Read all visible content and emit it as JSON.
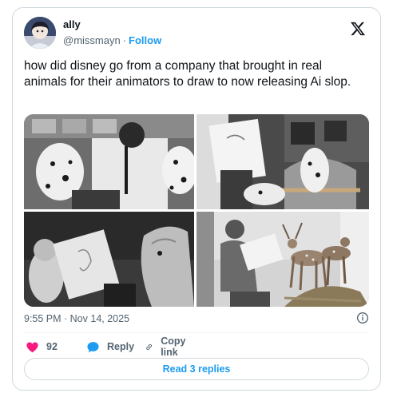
{
  "author": {
    "display_name": "ally",
    "handle": "@missmayn",
    "separator": "·",
    "follow_label": "Follow"
  },
  "tweet": {
    "text": "how did disney go from a company that brought in real animals for their animators to draw to now releasing Ai slop.",
    "timestamp": "9:55 PM · Nov 14, 2025"
  },
  "media": {
    "count": 4,
    "descriptions": [
      "photo-1",
      "photo-2",
      "photo-3",
      "photo-4"
    ]
  },
  "actions": {
    "like_count": "92",
    "reply_label": "Reply",
    "copy_link_label": "Copy link"
  },
  "read_replies_label": "Read 3 replies",
  "colors": {
    "accent": "#1d9bf0",
    "like": "#f91880",
    "text": "#0f1419",
    "muted": "#536471",
    "border": "#cfd9de"
  },
  "icons": [
    "x-logo-icon",
    "info-icon",
    "heart-icon",
    "reply-bubble-icon",
    "link-icon"
  ]
}
